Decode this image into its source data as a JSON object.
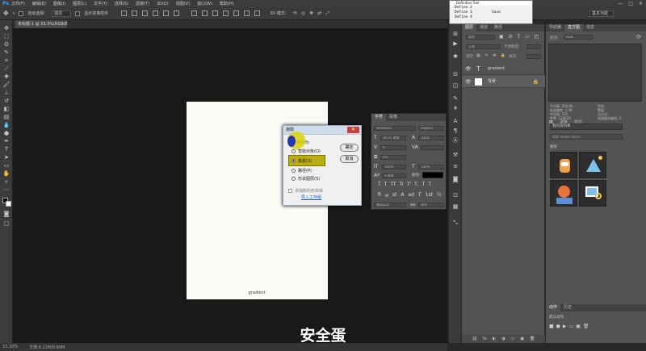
{
  "menubar": {
    "logo": "Ps",
    "items": [
      "文件(F)",
      "编辑(E)",
      "图像(I)",
      "图层(L)",
      "文字(Y)",
      "选择(S)",
      "滤镜(T)",
      "3D(D)",
      "视图(V)",
      "窗口(W)",
      "帮助(H)"
    ],
    "controls": [
      "—",
      "□",
      "✕"
    ]
  },
  "options": {
    "auto_select_label": "自动选择：",
    "auto_select_value": "图层",
    "show_transform_label": "显示变换控件",
    "mode_label": "3D 模式：",
    "workspace": "基本功能"
  },
  "document": {
    "tab_label": "未标题-1 @ 33.3%(RGB/8) *",
    "caption": "gradient"
  },
  "status": {
    "zoom": "33.33%",
    "doc_info": "文档:6.22M/0.80M"
  },
  "dialog": {
    "title": "拾取",
    "close_glyph": "✕",
    "section_label": "转换为:",
    "options": [
      {
        "label": "智能对象(O)",
        "selected": false
      },
      {
        "label": "像素(X)",
        "selected": true
      },
      {
        "label": "路径(P)",
        "selected": false
      },
      {
        "label": "形状图层(S)",
        "selected": false
      }
    ],
    "checkbox_label": "添加新的形状库",
    "link": "导入工作组",
    "ok": "确定",
    "cancel": "取消"
  },
  "character_panel": {
    "tabs": [
      "字符",
      "段落"
    ],
    "font_family": "Helvetica",
    "font_style": "Regular",
    "font_size": "36.42 像素",
    "leading": "(自动)",
    "kerning": "0",
    "tracking": "0%",
    "vertical_scale": "100%",
    "horizontal_scale": "100%",
    "baseline_shift": "0 像素",
    "color_label": "颜色:",
    "language": "美国英语",
    "antialias": "锐利",
    "style_glyphs": [
      "T",
      "T",
      "TT",
      "Tr",
      "T'",
      "T,",
      "T",
      "T"
    ],
    "feature_glyphs": [
      "fi",
      "ꝍ",
      "st",
      "A",
      "ad",
      "T",
      "1st",
      "½"
    ]
  },
  "definition_tool": {
    "title": "Definition Tool",
    "lines": [
      "Define 2",
      "Define 3         Save",
      "Define 4"
    ]
  },
  "layers_panel": {
    "tabs": [
      "图层",
      "通道",
      "路径"
    ],
    "kind_label": "类型",
    "blend_mode": "正常",
    "opacity_label": "不透明度:",
    "lock_label": "锁定:",
    "fill_label": "填充:",
    "layers": [
      {
        "name": "gradient",
        "type": "text",
        "glyph": "T"
      },
      {
        "name": "背景",
        "type": "background",
        "glyph": ""
      }
    ],
    "footer_icons": [
      "⛓",
      "fx",
      "◐",
      "◑",
      "▭",
      "▣",
      "🗑"
    ]
  },
  "right_panel": {
    "tabs": [
      "导航器",
      "直方图",
      "信息"
    ],
    "source_label": "通道:",
    "source_value": "RGB",
    "histogram_stats": [
      {
        "k": "平均值:",
        "v": "254.90"
      },
      {
        "k": "标准偏差:",
        "v": "2.49"
      },
      {
        "k": "中间值:",
        "v": "255"
      },
      {
        "k": "像素:",
        "v": "126036"
      }
    ],
    "histogram_stats_right": [
      {
        "k": "色阶:",
        "v": ""
      },
      {
        "k": "数量:",
        "v": ""
      },
      {
        "k": "百分位:",
        "v": ""
      },
      {
        "k": "高速缓存级别:",
        "v": "3"
      }
    ],
    "lib_tabs": [
      "库",
      "调整",
      "样式"
    ],
    "library_select": "我的资料库",
    "library_search": "搜索 Adobe Stock",
    "graphics_label": "图形",
    "actions_tabs": [
      "动作",
      "历史"
    ],
    "actions_item": "默认动作"
  },
  "subtitle": "安全蛋"
}
